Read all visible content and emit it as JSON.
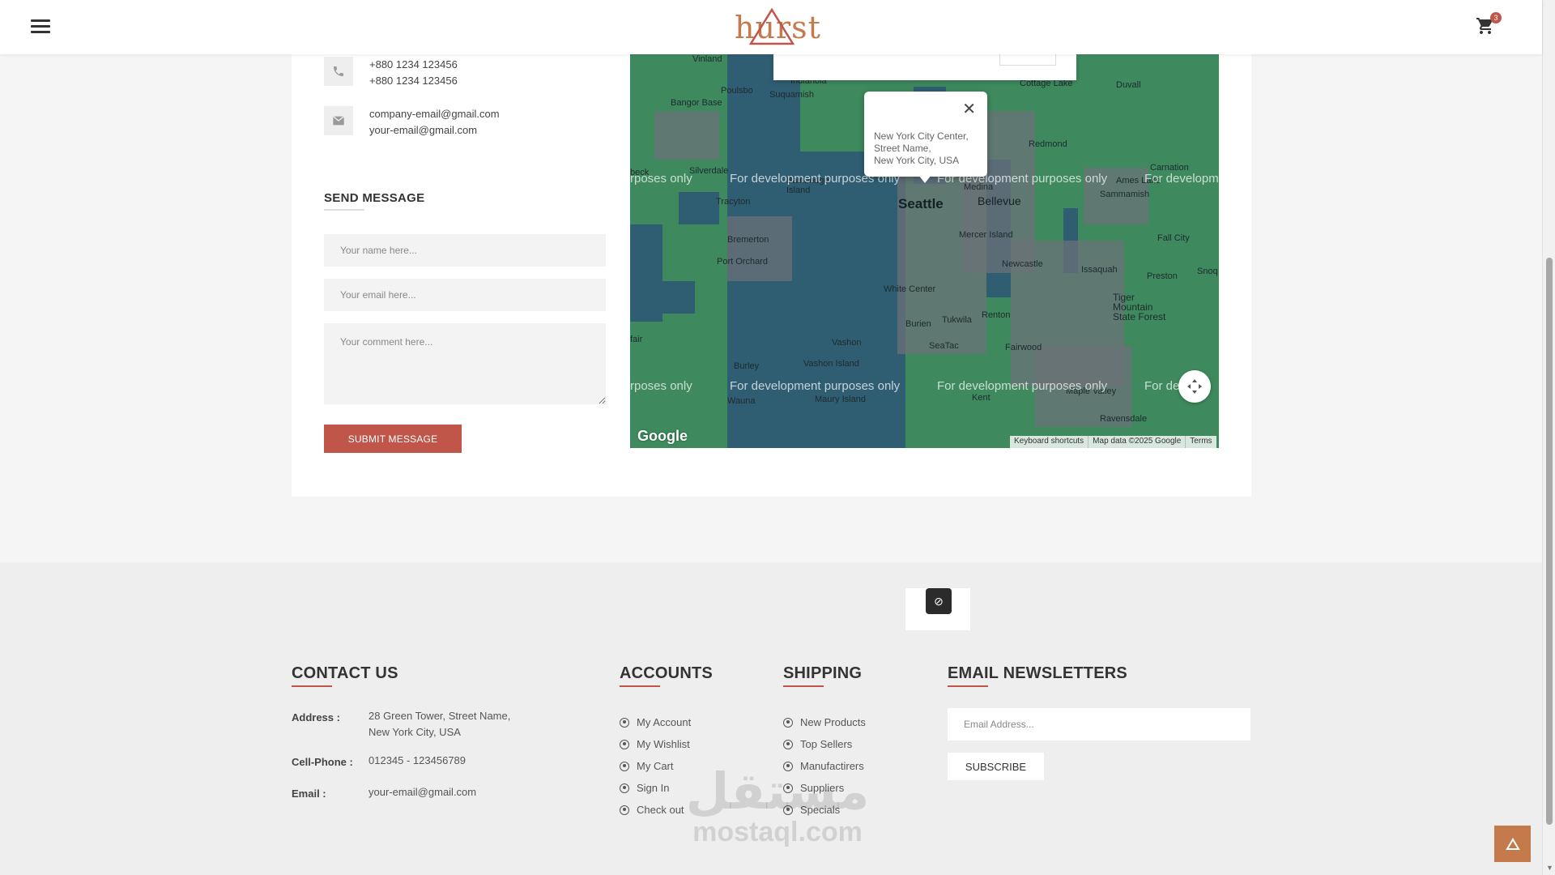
{
  "header": {
    "logo_text": "hurst",
    "cart_count": "3",
    "icons": [
      "hamburger-menu-icon",
      "cart-icon"
    ]
  },
  "contact_info": {
    "phones": [
      "+880 1234 123456",
      "+880 1234 123456"
    ],
    "emails": [
      "company-email@gmail.com",
      "your-email@gmail.com"
    ],
    "icons": [
      "phone-icon",
      "email-icon"
    ]
  },
  "send_message": {
    "title": "SEND MESSAGE",
    "name_placeholder": "Your name here...",
    "email_placeholder": "Your email here...",
    "comment_placeholder": "Your comment here...",
    "submit_label": "SUBMIT MESSAGE"
  },
  "map": {
    "popup_address": [
      "New York City Center,",
      "Street Name,",
      "New York City, USA"
    ],
    "dev_text": "For development purposes only",
    "dev_text_partial_left": "rposes only",
    "dev_text_partial_right": "For developm",
    "dev_text_partial_right2": "For de",
    "google": "Google",
    "footer": [
      "Keyboard shortcuts",
      "Map data ©2025 Google",
      "Terms"
    ],
    "places": {
      "seattle": "Seattle",
      "bellevue": "Bellevue",
      "vinland": "Vinland",
      "poulsbo": "Poulsbo",
      "indianola": "Indianola",
      "suquamish": "Suquamish",
      "bangor_base": "Bangor Base",
      "cottage_lake": "Cottage Lake",
      "duvall": "Duvall",
      "redmond": "Redmond",
      "carnation": "Carnation",
      "ames_lake": "Ames Lake",
      "sammamish": "Sammamish",
      "medina": "Medina",
      "silverdale": "Silverdale",
      "bainbridge_island": "Bainbridge Island",
      "tracyton": "Tracyton",
      "bremerton": "Bremerton",
      "port_orchard": "Port Orchard",
      "mercer_island": "Mercer Island",
      "fall_city": "Fall City",
      "newcastle": "Newcastle",
      "issaquah": "Issaquah",
      "preston": "Preston",
      "white_center": "White Center",
      "burien": "Burien",
      "tukwila": "Tukwila",
      "renton": "Renton",
      "tiger_mountain": "Tiger Mountain State Forest",
      "vashon": "Vashon",
      "seatac": "SeaTac",
      "fairwood": "Fairwood",
      "vashon_island": "Vashon Island",
      "burley": "Burley",
      "maury_island": "Maury Island",
      "wauna": "Wauna",
      "kent": "Kent",
      "maple_valley": "Maple Valley",
      "ravensdale": "Ravensdale",
      "fair": "fair",
      "beck": "beck",
      "snoq": "Snoq"
    }
  },
  "footer": {
    "contact": {
      "title": "CONTACT US",
      "address_label": "Address :",
      "address_lines": [
        "28 Green Tower, Street Name,",
        "New York City, USA"
      ],
      "phone_label": "Cell-Phone :",
      "phone": "012345 - 123456789",
      "email_label": "Email :",
      "email": "your-email@gmail.com"
    },
    "accounts": {
      "title": "ACCOUNTS",
      "items": [
        "My Account",
        "My Wishlist",
        "My Cart",
        "Sign In",
        "Check out"
      ]
    },
    "shipping": {
      "title": "SHIPPING",
      "items": [
        "New Products",
        "Top Sellers",
        "Manufactirers",
        "Suppliers",
        "Specials"
      ]
    },
    "newsletter": {
      "title": "EMAIL NEWSLETTERS",
      "placeholder": "Email Address...",
      "subscribe_label": "SUBSCRIBE"
    }
  },
  "watermark": {
    "arabic": "مستقل",
    "latin": "mostaql.com"
  },
  "colors": {
    "accent": "#c0554a",
    "logo": "#c47a4a",
    "map_land": "#3e8a5e",
    "map_water": "#2f5e72"
  }
}
